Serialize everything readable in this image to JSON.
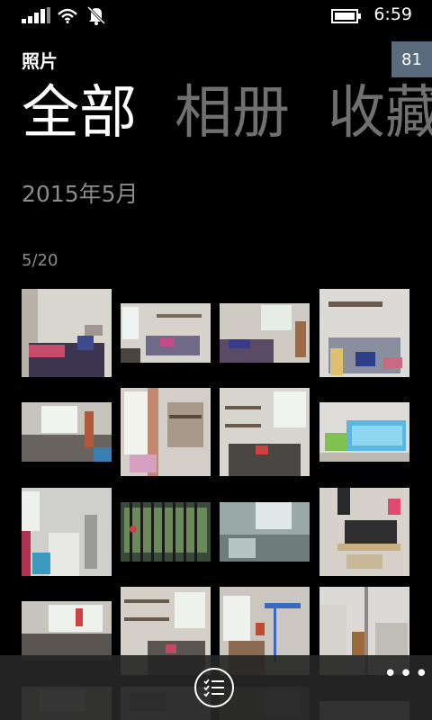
{
  "status_bar": {
    "time": "6:59",
    "icons": [
      "signal-icon",
      "wifi-icon",
      "bell-off-icon",
      "battery-icon"
    ]
  },
  "app": {
    "title": "照片",
    "notification_badge": "81"
  },
  "pivot": {
    "items": [
      {
        "label": "全部",
        "active": true
      },
      {
        "label": "相册",
        "active": false
      },
      {
        "label": "收藏",
        "active": false
      }
    ]
  },
  "timeline": {
    "month_header": "2015年5月",
    "day_label": "5/20"
  },
  "colors": {
    "background": "#000000",
    "badge": "#5b6b7e",
    "inactive_pivot": "#707070",
    "secondary_text": "#8c8c8c",
    "appbar": "#262626"
  },
  "appbar": {
    "icons": [
      "select-list-icon",
      "more-ellipsis-icon"
    ],
    "more_label": "•••"
  }
}
